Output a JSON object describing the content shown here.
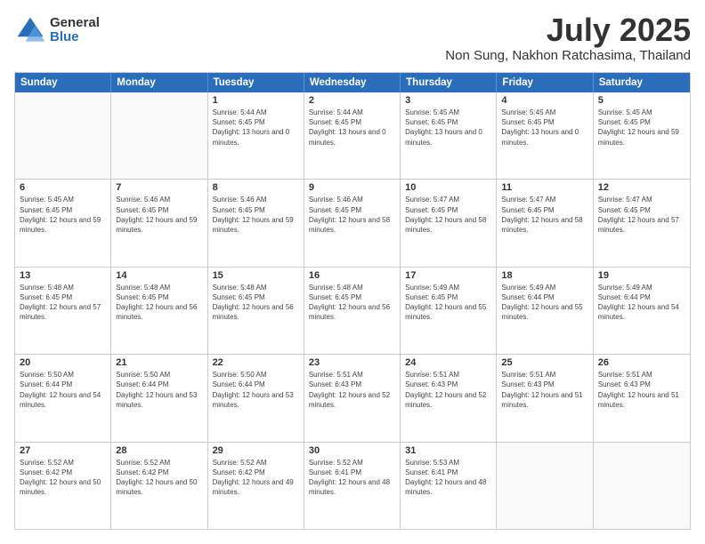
{
  "logo": {
    "line1": "General",
    "line2": "Blue"
  },
  "title": "July 2025",
  "location": "Non Sung, Nakhon Ratchasima, Thailand",
  "days_of_week": [
    "Sunday",
    "Monday",
    "Tuesday",
    "Wednesday",
    "Thursday",
    "Friday",
    "Saturday"
  ],
  "weeks": [
    [
      {
        "day": "",
        "empty": true
      },
      {
        "day": "",
        "empty": true
      },
      {
        "day": "1",
        "sunrise": "5:44 AM",
        "sunset": "6:45 PM",
        "daylight": "13 hours and 0 minutes."
      },
      {
        "day": "2",
        "sunrise": "5:44 AM",
        "sunset": "6:45 PM",
        "daylight": "13 hours and 0 minutes."
      },
      {
        "day": "3",
        "sunrise": "5:45 AM",
        "sunset": "6:45 PM",
        "daylight": "13 hours and 0 minutes."
      },
      {
        "day": "4",
        "sunrise": "5:45 AM",
        "sunset": "6:45 PM",
        "daylight": "13 hours and 0 minutes."
      },
      {
        "day": "5",
        "sunrise": "5:45 AM",
        "sunset": "6:45 PM",
        "daylight": "12 hours and 59 minutes."
      }
    ],
    [
      {
        "day": "6",
        "sunrise": "5:45 AM",
        "sunset": "6:45 PM",
        "daylight": "12 hours and 59 minutes."
      },
      {
        "day": "7",
        "sunrise": "5:46 AM",
        "sunset": "6:45 PM",
        "daylight": "12 hours and 59 minutes."
      },
      {
        "day": "8",
        "sunrise": "5:46 AM",
        "sunset": "6:45 PM",
        "daylight": "12 hours and 59 minutes."
      },
      {
        "day": "9",
        "sunrise": "5:46 AM",
        "sunset": "6:45 PM",
        "daylight": "12 hours and 58 minutes."
      },
      {
        "day": "10",
        "sunrise": "5:47 AM",
        "sunset": "6:45 PM",
        "daylight": "12 hours and 58 minutes."
      },
      {
        "day": "11",
        "sunrise": "5:47 AM",
        "sunset": "6:45 PM",
        "daylight": "12 hours and 58 minutes."
      },
      {
        "day": "12",
        "sunrise": "5:47 AM",
        "sunset": "6:45 PM",
        "daylight": "12 hours and 57 minutes."
      }
    ],
    [
      {
        "day": "13",
        "sunrise": "5:48 AM",
        "sunset": "6:45 PM",
        "daylight": "12 hours and 57 minutes."
      },
      {
        "day": "14",
        "sunrise": "5:48 AM",
        "sunset": "6:45 PM",
        "daylight": "12 hours and 56 minutes."
      },
      {
        "day": "15",
        "sunrise": "5:48 AM",
        "sunset": "6:45 PM",
        "daylight": "12 hours and 56 minutes."
      },
      {
        "day": "16",
        "sunrise": "5:48 AM",
        "sunset": "6:45 PM",
        "daylight": "12 hours and 56 minutes."
      },
      {
        "day": "17",
        "sunrise": "5:49 AM",
        "sunset": "6:45 PM",
        "daylight": "12 hours and 55 minutes."
      },
      {
        "day": "18",
        "sunrise": "5:49 AM",
        "sunset": "6:44 PM",
        "daylight": "12 hours and 55 minutes."
      },
      {
        "day": "19",
        "sunrise": "5:49 AM",
        "sunset": "6:44 PM",
        "daylight": "12 hours and 54 minutes."
      }
    ],
    [
      {
        "day": "20",
        "sunrise": "5:50 AM",
        "sunset": "6:44 PM",
        "daylight": "12 hours and 54 minutes."
      },
      {
        "day": "21",
        "sunrise": "5:50 AM",
        "sunset": "6:44 PM",
        "daylight": "12 hours and 53 minutes."
      },
      {
        "day": "22",
        "sunrise": "5:50 AM",
        "sunset": "6:44 PM",
        "daylight": "12 hours and 53 minutes."
      },
      {
        "day": "23",
        "sunrise": "5:51 AM",
        "sunset": "6:43 PM",
        "daylight": "12 hours and 52 minutes."
      },
      {
        "day": "24",
        "sunrise": "5:51 AM",
        "sunset": "6:43 PM",
        "daylight": "12 hours and 52 minutes."
      },
      {
        "day": "25",
        "sunrise": "5:51 AM",
        "sunset": "6:43 PM",
        "daylight": "12 hours and 51 minutes."
      },
      {
        "day": "26",
        "sunrise": "5:51 AM",
        "sunset": "6:43 PM",
        "daylight": "12 hours and 51 minutes."
      }
    ],
    [
      {
        "day": "27",
        "sunrise": "5:52 AM",
        "sunset": "6:42 PM",
        "daylight": "12 hours and 50 minutes."
      },
      {
        "day": "28",
        "sunrise": "5:52 AM",
        "sunset": "6:42 PM",
        "daylight": "12 hours and 50 minutes."
      },
      {
        "day": "29",
        "sunrise": "5:52 AM",
        "sunset": "6:42 PM",
        "daylight": "12 hours and 49 minutes."
      },
      {
        "day": "30",
        "sunrise": "5:52 AM",
        "sunset": "6:41 PM",
        "daylight": "12 hours and 48 minutes."
      },
      {
        "day": "31",
        "sunrise": "5:53 AM",
        "sunset": "6:41 PM",
        "daylight": "12 hours and 48 minutes."
      },
      {
        "day": "",
        "empty": true
      },
      {
        "day": "",
        "empty": true
      }
    ]
  ]
}
